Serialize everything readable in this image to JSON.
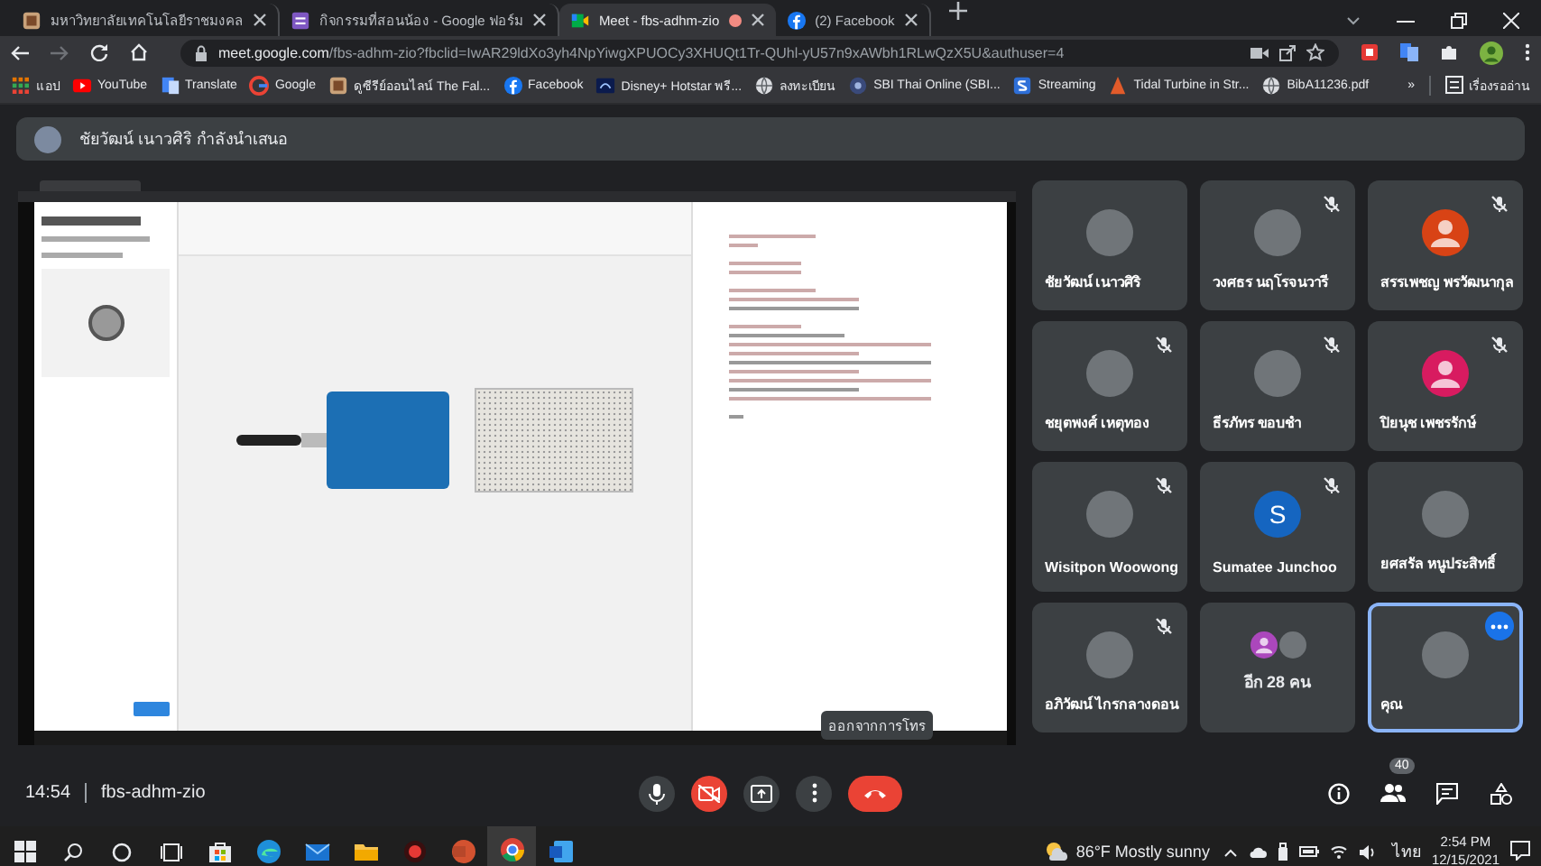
{
  "browser": {
    "tabs": [
      {
        "title": "มหาวิทยาลัยเทคโนโลยีราชมงคล",
        "kind": "page",
        "selected": false,
        "recording": false
      },
      {
        "title": "กิจกรรมที่สอนน้อง - Google ฟอร์ม",
        "kind": "forms",
        "selected": false,
        "recording": false
      },
      {
        "title": "Meet - fbs-adhm-zio",
        "kind": "meet",
        "selected": true,
        "recording": true
      },
      {
        "title": "(2) Facebook",
        "kind": "facebook",
        "selected": false,
        "recording": false
      }
    ],
    "url": {
      "domain": "meet.google.com",
      "path": "/fbs-adhm-zio?fbclid=IwAR29ldXo3yh4NpYiwgXPUOCy3XHUQt1Tr-QUhl-yU57n9xAWbh1RLwQzX5U&authuser=4"
    },
    "bookmarks": [
      {
        "label": "แอป",
        "kind": "apps"
      },
      {
        "label": "YouTube",
        "kind": "youtube"
      },
      {
        "label": "Translate",
        "kind": "translate"
      },
      {
        "label": "Google",
        "kind": "google"
      },
      {
        "label": "ดูซีรีย์ออนไลน์ The Fal...",
        "kind": "page"
      },
      {
        "label": "Facebook",
        "kind": "facebook"
      },
      {
        "label": "Disney+ Hotstar พรี...",
        "kind": "disney"
      },
      {
        "label": "ลงทะเบียน",
        "kind": "globe"
      },
      {
        "label": "SBI Thai Online (SBI...",
        "kind": "sbi"
      },
      {
        "label": "Streaming",
        "kind": "streaming"
      },
      {
        "label": "Tidal Turbine in Str...",
        "kind": "tidal"
      },
      {
        "label": "BibA11236.pdf",
        "kind": "globe"
      }
    ],
    "bookmarks_more": "»",
    "reading_list": "เรื่องรออ่าน"
  },
  "meet": {
    "presenter_banner": "ชัยวัฒน์ เนาวศิริ กำลังนำเสนอ",
    "tiles": [
      {
        "name": "ชัยวัฒน์ เนาวศิริ",
        "kind": "photo",
        "muted": false,
        "selected": false
      },
      {
        "name": "วงศธร นฤโรจนวารี",
        "kind": "photo",
        "muted": true,
        "selected": false
      },
      {
        "name": "สรรเพชญ พรวัฒนากุล",
        "kind": "default",
        "color": "#d84315",
        "muted": true,
        "selected": false
      },
      {
        "name": "ชยุตพงศ์ เหตุทอง",
        "kind": "photo",
        "muted": true,
        "selected": false
      },
      {
        "name": "ธีรภัทร ขอบชำ",
        "kind": "photo",
        "muted": true,
        "selected": false
      },
      {
        "name": "ปิยนุช เพชรรักษ์",
        "kind": "default",
        "color": "#d81b60",
        "muted": true,
        "selected": false
      },
      {
        "name": "Wisitpon Woowong",
        "kind": "photo",
        "muted": true,
        "selected": false
      },
      {
        "name": "Sumatee Junchoo",
        "kind": "letter",
        "letter": "S",
        "color": "#1565c0",
        "muted": true,
        "selected": false
      },
      {
        "name": "ยศสรัล หนูประสิทธิ์",
        "kind": "photo",
        "muted": false,
        "selected": false
      },
      {
        "name": "อภิวัฒน์ ไกรกลางดอน",
        "kind": "photo",
        "muted": true,
        "selected": false
      },
      {
        "name": "อีก 28 คน",
        "kind": "others",
        "muted": false,
        "selected": false
      },
      {
        "name": "คุณ",
        "kind": "self",
        "muted": false,
        "selected": true
      }
    ],
    "time": "14:54",
    "meeting_code": "fbs-adhm-zio",
    "controls": [
      {
        "kind": "mic",
        "on": true
      },
      {
        "kind": "camera",
        "on": false
      },
      {
        "kind": "present"
      },
      {
        "kind": "more"
      },
      {
        "kind": "leave"
      }
    ],
    "tooltip": "ออกจากการโทร",
    "side_buttons": [
      {
        "kind": "info"
      },
      {
        "kind": "people",
        "badge": "40"
      },
      {
        "kind": "chat"
      },
      {
        "kind": "activities"
      }
    ]
  },
  "taskbar": {
    "apps": [
      {
        "kind": "store",
        "selected": false
      },
      {
        "kind": "edge",
        "selected": false
      },
      {
        "kind": "mail",
        "selected": false
      },
      {
        "kind": "explorer",
        "selected": false
      },
      {
        "kind": "record",
        "selected": false
      },
      {
        "kind": "powerpoint",
        "selected": false
      },
      {
        "kind": "chrome",
        "selected": true
      },
      {
        "kind": "word",
        "selected": false
      }
    ],
    "weather": "86°F Mostly sunny",
    "language": "ไทย",
    "time": "2:54 PM",
    "date": "12/15/2021"
  }
}
